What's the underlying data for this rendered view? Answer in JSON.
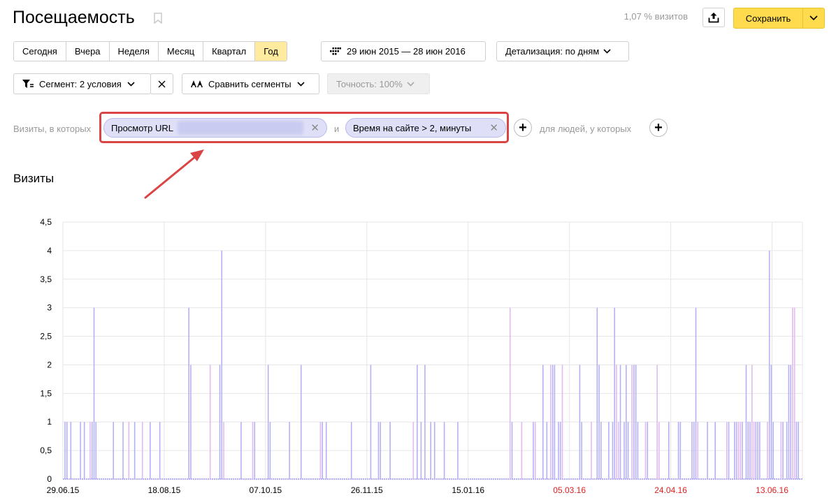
{
  "header": {
    "title": "Посещаемость",
    "visits_share": "1,07 % визитов",
    "save_label": "Сохранить"
  },
  "period": {
    "buttons": [
      "Сегодня",
      "Вчера",
      "Неделя",
      "Месяц",
      "Квартал",
      "Год"
    ],
    "active": "Год",
    "date_range": "29 июн 2015 — 28 июн 2016",
    "detail_label": "Детализация: по дням"
  },
  "segment": {
    "label": "Сегмент: 2 условия",
    "compare_label": "Сравнить сегменты",
    "accuracy_label": "Точность: 100%"
  },
  "filter": {
    "prefix": "Визиты, в которых",
    "chip1": "Просмотр URL",
    "joiner": "и",
    "chip2": "Время на сайте > 2, минуты",
    "people_label": "для людей, у которых"
  },
  "section": {
    "title": "Визиты"
  },
  "colors": {
    "bar": "#b5b1f6",
    "bar_alt": "#e1b9f3",
    "holiday": "#e02020",
    "accent": "#ffdb4d",
    "highlight": "#d94545"
  },
  "chart_data": {
    "type": "bar",
    "ylim": [
      0,
      4.5
    ],
    "yticks": [
      "0",
      "0,5",
      "1",
      "1,5",
      "2",
      "2,5",
      "3",
      "3,5",
      "4",
      "4,5"
    ],
    "xticks": [
      {
        "label": "29.06.15",
        "holiday": false
      },
      {
        "label": "18.08.15",
        "holiday": false
      },
      {
        "label": "07.10.15",
        "holiday": false
      },
      {
        "label": "26.11.15",
        "holiday": false
      },
      {
        "label": "15.01.16",
        "holiday": false
      },
      {
        "label": "05.03.16",
        "holiday": true
      },
      {
        "label": "24.04.16",
        "holiday": true
      },
      {
        "label": "13.06.16",
        "holiday": true
      }
    ],
    "days": 366,
    "values": [
      1,
      1,
      0,
      1,
      0,
      0,
      0,
      0,
      1,
      0,
      1,
      0,
      0,
      1,
      1,
      3,
      1,
      0,
      0,
      0,
      0,
      0,
      0,
      0,
      0,
      1,
      0,
      0,
      0,
      0,
      1,
      0,
      0,
      1,
      0,
      0,
      1,
      0,
      0,
      0,
      1,
      0,
      0,
      0,
      1,
      0,
      0,
      0,
      0,
      1,
      0,
      0,
      0,
      0,
      0,
      0,
      0,
      0,
      0,
      0,
      0,
      0,
      0,
      0,
      3,
      2,
      0,
      0,
      0,
      0,
      0,
      0,
      0,
      0,
      0,
      2,
      0,
      0,
      0,
      0,
      2,
      4,
      1,
      0,
      0,
      0,
      0,
      0,
      0,
      0,
      0,
      1,
      0,
      0,
      0,
      0,
      0,
      1,
      1,
      0,
      0,
      0,
      0,
      0,
      0,
      2,
      1,
      0,
      0,
      0,
      0,
      0,
      0,
      0,
      0,
      0,
      1,
      0,
      0,
      0,
      0,
      0,
      2,
      0,
      0,
      0,
      0,
      0,
      0,
      0,
      0,
      0,
      1,
      1,
      0,
      1,
      0,
      0,
      0,
      0,
      0,
      0,
      0,
      0,
      0,
      0,
      0,
      0,
      1,
      0,
      0,
      0,
      0,
      0,
      0,
      0,
      0,
      0,
      2,
      0,
      0,
      0,
      1,
      1,
      0,
      0,
      0,
      0,
      1,
      0,
      0,
      0,
      0,
      0,
      0,
      0,
      0,
      0,
      0,
      0,
      1,
      0,
      2,
      0,
      1,
      0,
      2,
      0,
      0,
      1,
      0,
      1,
      0,
      0,
      0,
      0,
      1,
      0,
      0,
      0,
      0,
      0,
      0,
      1,
      0,
      0,
      0,
      0,
      0,
      0,
      0,
      0,
      0,
      0,
      0,
      0,
      0,
      0,
      0,
      0,
      0,
      0,
      0,
      0,
      0,
      0,
      0,
      0,
      0,
      0,
      3,
      1,
      0,
      0,
      0,
      0,
      1,
      0,
      0,
      0,
      0,
      0,
      1,
      1,
      0,
      0,
      0,
      2,
      0,
      1,
      0,
      2,
      2,
      2,
      0,
      1,
      1,
      2,
      0,
      0,
      0,
      0,
      0,
      0,
      0,
      0,
      2,
      1,
      0,
      0,
      0,
      0,
      1,
      0,
      0,
      3,
      2,
      1,
      0,
      0,
      0,
      1,
      0,
      1,
      3,
      2,
      1,
      2,
      0,
      1,
      2,
      1,
      0,
      2,
      2,
      2,
      1,
      0,
      0,
      0,
      1,
      1,
      0,
      0,
      0,
      0,
      2,
      1,
      0,
      0,
      0,
      0,
      1,
      0,
      0,
      0,
      0,
      1,
      1,
      0,
      0,
      0,
      0,
      0,
      1,
      1,
      3,
      1,
      0,
      0,
      0,
      0,
      1,
      0,
      0,
      0,
      1,
      0,
      0,
      0,
      0,
      0,
      1,
      1,
      0,
      0,
      1,
      1,
      1,
      1,
      1,
      0,
      2,
      1,
      1,
      2,
      1,
      1,
      1,
      1,
      0,
      0,
      0,
      1,
      4,
      2,
      1,
      0,
      0,
      0,
      1,
      1,
      0,
      1,
      2,
      2,
      3,
      3,
      1,
      1
    ]
  }
}
